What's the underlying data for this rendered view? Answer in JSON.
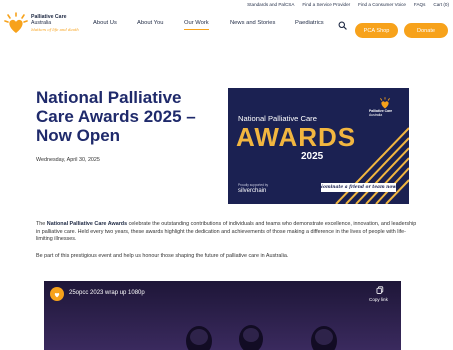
{
  "utility": {
    "links": [
      "Standards and PalCSA",
      "Find a Service Provider",
      "Find a Consumer Voice",
      "FAQs",
      "Cart (0)"
    ]
  },
  "logo": {
    "line1": "Palliative Care",
    "line2": "Australia",
    "tagline": "Matters of life and death"
  },
  "nav": {
    "items": [
      "About Us",
      "About You",
      "Our Work",
      "News and Stories",
      "Paediatrics"
    ],
    "active": "Our Work",
    "shop_label": "PCA Shop",
    "donate_label": "Donate"
  },
  "article": {
    "title": "National Palliative Care Awards 2025 – Now Open",
    "date": "Wednesday, April 30, 2025",
    "p1_pre": "The ",
    "p1_bold": "National Palliative Care Awards",
    "p1_post": " celebrate the outstanding contributions of individuals and teams who demonstrate excellence, innovation, and leadership in palliative care. Held every two years, these awards highlight the dedication and achievements of those making a difference in the lives of people with life-limiting illnesses.",
    "p2": "Be part of this prestigious event and help us honour those shaping the future of palliative care in Australia."
  },
  "banner": {
    "heading": "National Palliative Care",
    "awards": "AWARDS",
    "year": "2025",
    "logo_line1": "Palliative Care",
    "logo_line2": "Australia",
    "presented_by": "Proudly supported by",
    "sponsor": "silverchain",
    "cta": "Nominate a friend or team now!"
  },
  "video": {
    "title": "25opcc 2023 wrap up 1080p",
    "copy_label": "Copy link"
  },
  "colors": {
    "brand_navy": "#1f2a6b",
    "accent_orange": "#f7a21b",
    "banner_bg": "#1b2152",
    "awards_gold": "#f2b640"
  }
}
